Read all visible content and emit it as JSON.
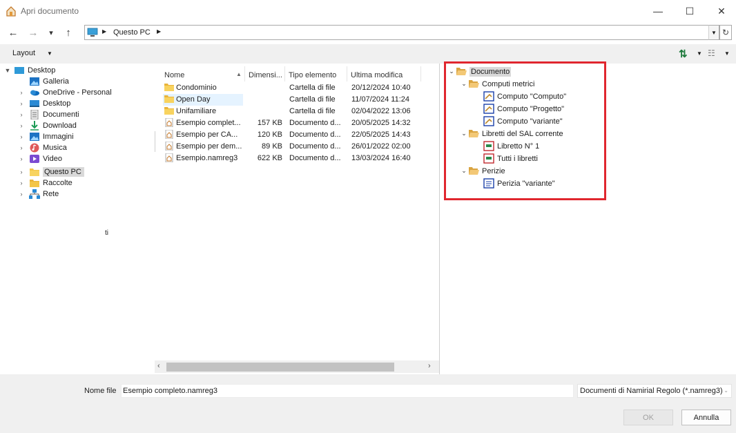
{
  "window": {
    "title": "Apri documento",
    "minimize_glyph": "—",
    "maximize_glyph": "☐",
    "close_glyph": "✕"
  },
  "nav": {
    "back_glyph": "←",
    "forward_glyph": "→",
    "recent_glyph": "▾",
    "up_glyph": "↑",
    "breadcrumb": [
      "Questo PC"
    ],
    "refresh_glyph": "↻"
  },
  "toolbar": {
    "layout_label": "Layout",
    "sort_glyph": "⇅",
    "view_glyph": "☷"
  },
  "sidebar": {
    "items": [
      {
        "label": "Desktop",
        "icon": "desktop-blue-icon",
        "expanded": true
      },
      {
        "label": "Galleria",
        "icon": "gallery-icon"
      },
      {
        "label": "OneDrive - Personal",
        "icon": "onedrive-icon"
      },
      {
        "label": "Desktop",
        "icon": "desktop-folder-icon"
      },
      {
        "label": "Documenti",
        "icon": "documents-icon"
      },
      {
        "label": "Download",
        "icon": "download-icon"
      },
      {
        "label": "Immagini",
        "icon": "pictures-icon"
      },
      {
        "label": "Musica",
        "icon": "music-icon"
      },
      {
        "label": "Video",
        "icon": "video-icon"
      },
      {
        "label": "Questo PC",
        "icon": "this-pc-icon",
        "selected": true
      },
      {
        "label": "Raccolte",
        "icon": "libraries-icon"
      },
      {
        "label": "Rete",
        "icon": "network-icon"
      }
    ],
    "stray_text": "ti"
  },
  "filelist": {
    "columns": [
      "Nome",
      "Dimensi...",
      "Tipo elemento",
      "Ultima modifica"
    ],
    "rows": [
      {
        "name": "Condominio",
        "size": "",
        "type": "Cartella di file",
        "date": "20/12/2024 10:40",
        "kind": "folder"
      },
      {
        "name": "Open Day",
        "size": "",
        "type": "Cartella di file",
        "date": "11/07/2024 11:24",
        "kind": "folder"
      },
      {
        "name": "Unifamiliare",
        "size": "",
        "type": "Cartella di file",
        "date": "02/04/2022 13:06",
        "kind": "folder"
      },
      {
        "name": "Esempio complet...",
        "size": "157 KB",
        "type": "Documento d...",
        "date": "20/05/2025 14:32",
        "kind": "doc"
      },
      {
        "name": "Esempio per CA...",
        "size": "120 KB",
        "type": "Documento d...",
        "date": "22/05/2025 14:43",
        "kind": "doc"
      },
      {
        "name": "Esempio per dem...",
        "size": "89 KB",
        "type": "Documento d...",
        "date": "26/01/2022 02:00",
        "kind": "doc"
      },
      {
        "name": "Esempio.namreg3",
        "size": "622 KB",
        "type": "Documento d...",
        "date": "13/03/2024 16:40",
        "kind": "doc"
      }
    ],
    "scroll_left_glyph": "‹",
    "scroll_right_glyph": "›"
  },
  "preview": {
    "root": "Documento",
    "groups": [
      {
        "label": "Computi metrici",
        "children": [
          "Computo \"Computo\"",
          "Computo \"Progetto\"",
          "Computo \"variante\""
        ],
        "child_icon": "computo-icon"
      },
      {
        "label": "Libretti del SAL corrente",
        "children": [
          "Libretto N° 1",
          "Tutti i libretti"
        ],
        "child_icon": "libretto-icon"
      },
      {
        "label": "Perizie",
        "children": [
          "Perizia \"variante\""
        ],
        "child_icon": "perizia-icon"
      }
    ],
    "highlight_color": "#e0262e"
  },
  "footer": {
    "filename_label": "Nome file",
    "filename_value": "Esempio completo.namreg3",
    "filter_value": "Documenti di Namirial Regolo (*.namreg3)",
    "ok_label": "OK",
    "cancel_label": "Annulla"
  }
}
